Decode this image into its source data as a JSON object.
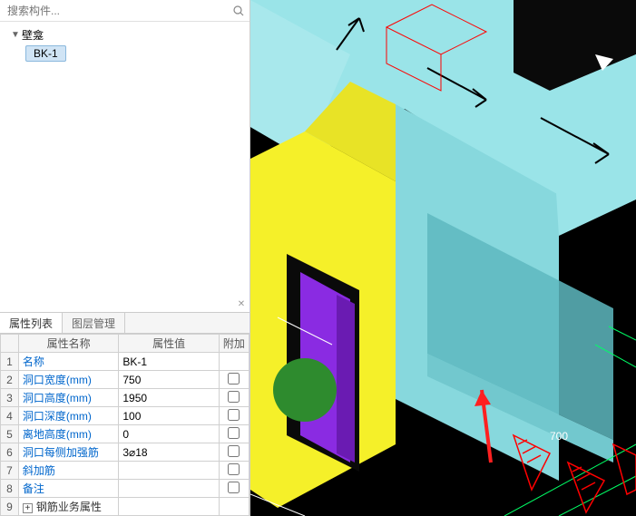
{
  "search": {
    "placeholder": "搜索构件..."
  },
  "tree": {
    "root_label": "壁龛",
    "child_label": "BK-1"
  },
  "tabs": {
    "properties": "属性列表",
    "layers": "图层管理"
  },
  "table": {
    "headers": {
      "name": "属性名称",
      "value": "属性值",
      "add": "附加"
    },
    "rows": [
      {
        "num": "1",
        "name": "名称",
        "value": "BK-1",
        "link": true,
        "checkbox": false
      },
      {
        "num": "2",
        "name": "洞口宽度(mm)",
        "value": "750",
        "link": true,
        "checkbox": true
      },
      {
        "num": "3",
        "name": "洞口高度(mm)",
        "value": "1950",
        "link": true,
        "checkbox": true
      },
      {
        "num": "4",
        "name": "洞口深度(mm)",
        "value": "100",
        "link": true,
        "checkbox": true
      },
      {
        "num": "5",
        "name": "离地高度(mm)",
        "value": "0",
        "link": true,
        "checkbox": true
      },
      {
        "num": "6",
        "name": "洞口每侧加强筋",
        "value": "3⌀18",
        "link": true,
        "checkbox": true
      },
      {
        "num": "7",
        "name": "斜加筋",
        "value": "",
        "link": true,
        "checkbox": true
      },
      {
        "num": "8",
        "name": "备注",
        "value": "",
        "link": true,
        "checkbox": true
      },
      {
        "num": "9",
        "name": "钢筋业务属性",
        "value": "",
        "link": false,
        "checkbox": false,
        "expandable": true
      }
    ]
  },
  "viewport": {
    "dimension_label": "700"
  }
}
